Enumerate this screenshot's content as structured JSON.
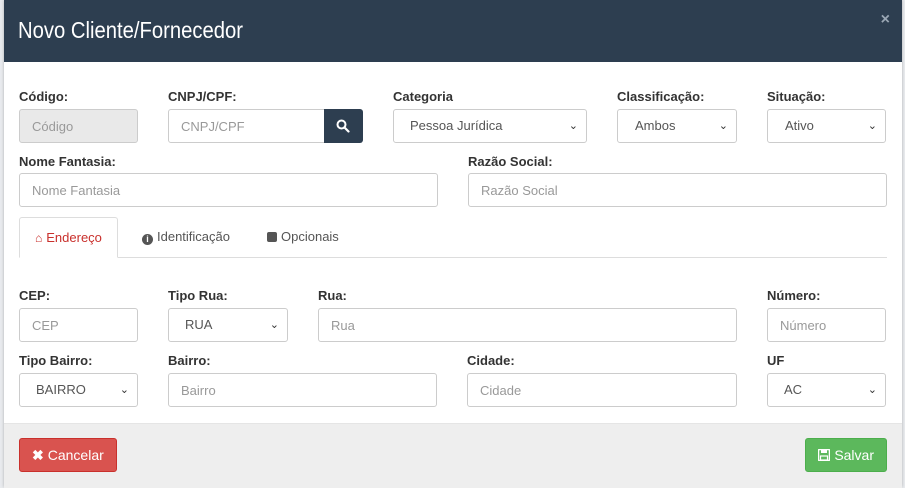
{
  "modal": {
    "title": "Novo Cliente/Fornecedor",
    "close": "×"
  },
  "form": {
    "codigo": {
      "label": "Código:",
      "placeholder": "Código"
    },
    "cnpj": {
      "label": "CNPJ/CPF:",
      "placeholder": "CNPJ/CPF"
    },
    "categoria": {
      "label": "Categoria",
      "value": "Pessoa Jurídica"
    },
    "classificacao": {
      "label": "Classificação:",
      "value": "Ambos"
    },
    "situacao": {
      "label": "Situação:",
      "value": "Ativo"
    },
    "nome_fantasia": {
      "label": "Nome Fantasia:",
      "placeholder": "Nome Fantasia"
    },
    "razao_social": {
      "label": "Razão Social:",
      "placeholder": "Razão Social"
    }
  },
  "tabs": [
    {
      "label": "Endereço",
      "icon": "home-icon",
      "active": true
    },
    {
      "label": "Identificação",
      "icon": "info-circle-icon",
      "active": false
    },
    {
      "label": "Opcionais",
      "icon": "puzzle-piece-icon",
      "active": false
    }
  ],
  "address": {
    "cep": {
      "label": "CEP:",
      "placeholder": "CEP"
    },
    "tipo_rua": {
      "label": "Tipo Rua:",
      "value": "RUA"
    },
    "rua": {
      "label": "Rua:",
      "placeholder": "Rua"
    },
    "numero": {
      "label": "Número:",
      "placeholder": "Número"
    },
    "tipo_bairro": {
      "label": "Tipo Bairro:",
      "value": "BAIRRO"
    },
    "bairro": {
      "label": "Bairro:",
      "placeholder": "Bairro"
    },
    "cidade": {
      "label": "Cidade:",
      "placeholder": "Cidade"
    },
    "uf": {
      "label": "UF",
      "value": "AC"
    }
  },
  "footer": {
    "cancel_label": "Cancelar",
    "save_label": "Salvar"
  },
  "colors": {
    "header_bg": "#2d3e50",
    "active_tab": "#c9302c",
    "cancel": "#d9534f",
    "save": "#5cb85c"
  }
}
